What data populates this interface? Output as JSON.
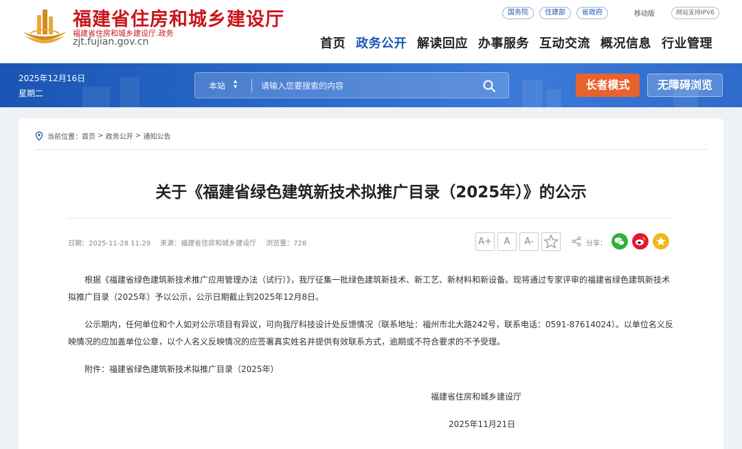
{
  "header": {
    "site_title": "福建省住房和城乡建设厅",
    "site_sub": "福建省住房和城乡建设厅.政务",
    "site_domain": "zjt.fujian.gov.cn",
    "toplinks": [
      "国务院",
      "住建部",
      "省政府"
    ],
    "mobile_label": "移动版",
    "ipv6_label": "网站支持IPV6",
    "nav": [
      "首页",
      "政务公开",
      "解读回应",
      "办事服务",
      "互动交流",
      "概况信息",
      "行业管理"
    ],
    "nav_active_index": 1
  },
  "banner": {
    "date": "2025年12月16日",
    "weekday": "星期二",
    "search_scope": "本站",
    "search_placeholder": "请输入您要搜索的内容",
    "elder_mode": "长者模式",
    "accessible": "无障碍浏览"
  },
  "breadcrumb": {
    "prefix": "当前位置：",
    "items": [
      "首页",
      "政务公开",
      "通知公告"
    ],
    "sep": " > "
  },
  "article": {
    "title": "关于《福建省绿色建筑新技术拟推广目录（2025年）》的公示",
    "meta_date": "日期：2025-11-28 11:29",
    "meta_source": "来源：福建省住房和城乡建设厅",
    "meta_views": "浏览量：728",
    "font_larger": "A+",
    "font_default": "A",
    "font_smaller": "A-",
    "share_label": "分享：",
    "paragraphs": [
      "根据《福建省绿色建筑新技术推广应用管理办法（试行）》，我厅征集一批绿色建筑新技术、新工艺、新材料和新设备。现将通过专家评审的福建省绿色建筑新技术拟推广目录（2025年）予以公示，公示日期截止到2025年12月8日。",
      "公示期内，任何单位和个人如对公示项目有异议，可向我厅科技设计处反馈情况（联系地址：福州市北大路242号，联系电话：0591-87614024）。以单位名义反映情况的应加盖单位公章，以个人名义反映情况的应签署真实姓名并提供有效联系方式，逾期或不符合要求的不予受理。",
      "附件：福建省绿色建筑新技术拟推广目录（2025年）"
    ],
    "signature_org": "福建省住房和城乡建设厅",
    "signature_date": "2025年11月21日"
  },
  "colors": {
    "brand_red": "#c8161d",
    "nav_blue": "#1f56b3",
    "banner_blue": "#2a6acb",
    "elder_orange": "#e8622d",
    "wechat_green": "#2fb338",
    "weibo_red": "#e6162d",
    "qzone_yellow": "#f2b51d"
  }
}
